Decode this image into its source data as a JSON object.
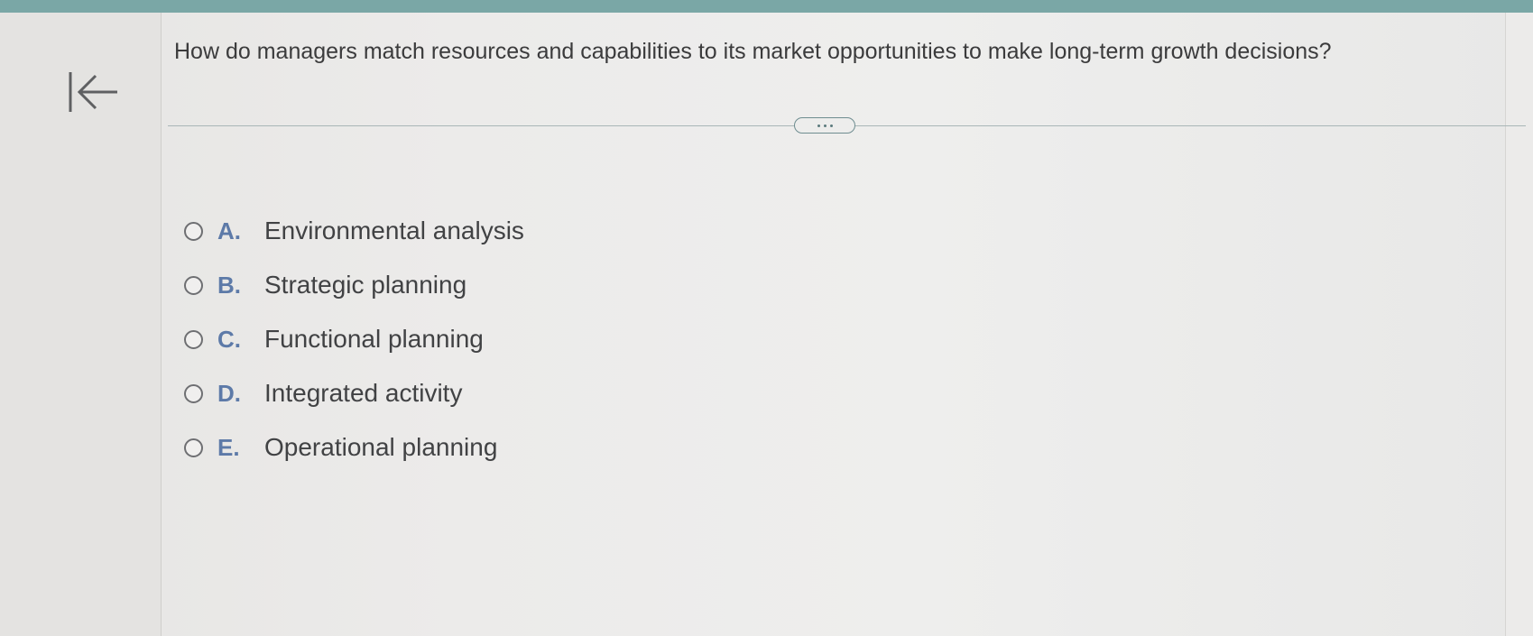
{
  "question": {
    "text": "How do managers match resources and capabilities to its market opportunities to make long-term growth decisions?"
  },
  "icons": {
    "back": "back-to-start-icon",
    "expand": "more-options-icon",
    "radio": "radio-button-icon"
  },
  "options": [
    {
      "letter": "A.",
      "text": "Environmental analysis"
    },
    {
      "letter": "B.",
      "text": "Strategic planning"
    },
    {
      "letter": "C.",
      "text": "Functional planning"
    },
    {
      "letter": "D.",
      "text": "Integrated activity"
    },
    {
      "letter": "E.",
      "text": "Operational planning"
    }
  ],
  "colors": {
    "accent_teal": "#7aa7a6",
    "option_letter": "#5d7aa8",
    "text": "#3b3b3c",
    "background": "#ebeae9"
  }
}
